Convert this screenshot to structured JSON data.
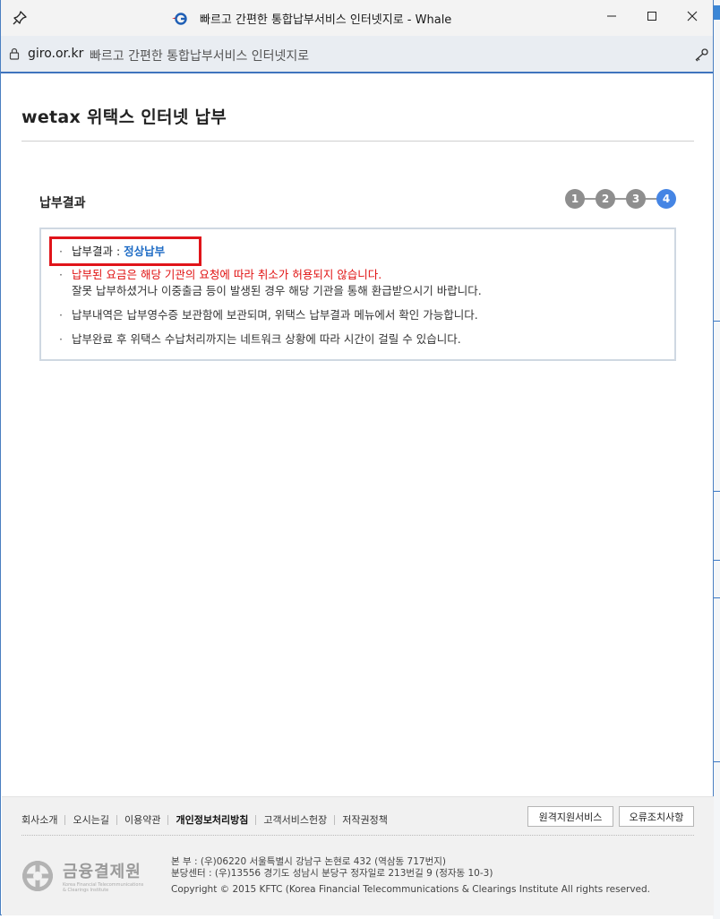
{
  "window": {
    "title": "빠르고 간편한 통합납부서비스 인터넷지로 - Whale"
  },
  "address_bar": {
    "domain": "giro.or.kr",
    "page_title": "빠르고 간편한 통합납부서비스 인터넷지로"
  },
  "page": {
    "title": "wetax 위택스 인터넷 납부",
    "section_title": "납부결과",
    "steps": [
      "1",
      "2",
      "3",
      "4"
    ],
    "active_step": 4
  },
  "result": {
    "label": "납부결과 : ",
    "value": "정상납부",
    "warning": "납부된 요금은 해당 기관의 요청에 따라 취소가 허용되지 않습니다.",
    "warning_detail": "잘못 납부하셨거나 이중출금 등이 발생된 경우 해당 기관을 통해 환급받으시기 바랍니다.",
    "note1": "납부내역은 납부영수증 보관함에 보관되며, 위택스 납부결과 메뉴에서 확인 가능합니다.",
    "note2": "납부완료 후 위택스 수납처리까지는 네트워크 상황에 따라 시간이 걸릴 수 있습니다.",
    "bullet": "·"
  },
  "footer": {
    "links": [
      "회사소개",
      "오시는길",
      "이용약관",
      "개인정보처리방침",
      "고객서비스헌장",
      "저작권정책"
    ],
    "remote_support_button": "원격지원서비스",
    "error_fix_button": "오류조치사항",
    "logo_name": "금융결제원",
    "logo_sub_line1": "Korea Financial Telecommunications",
    "logo_sub_line2": "& Clearings Institute",
    "address_hq": "본 부 : (우)06220 서울특별시 강남구 논현로 432 (역삼동 717번지)",
    "address_branch": "분당센터 : (우)13556 경기도 성남시 분당구 정자일로 213번길 9 (정자동 10-3)",
    "copyright": "Copyright © 2015 KFTC (Korea Financial Telecommunications & Clearings Institute All rights reserved."
  },
  "colors": {
    "accent": "#4585e4",
    "result_value": "#1f6cc5",
    "warning": "#e01010",
    "highlight": "#e0141a"
  },
  "icons": {
    "pin": "pin-icon",
    "favicon": "giro-favicon-icon",
    "lock": "lock-icon",
    "key": "key-icon"
  }
}
